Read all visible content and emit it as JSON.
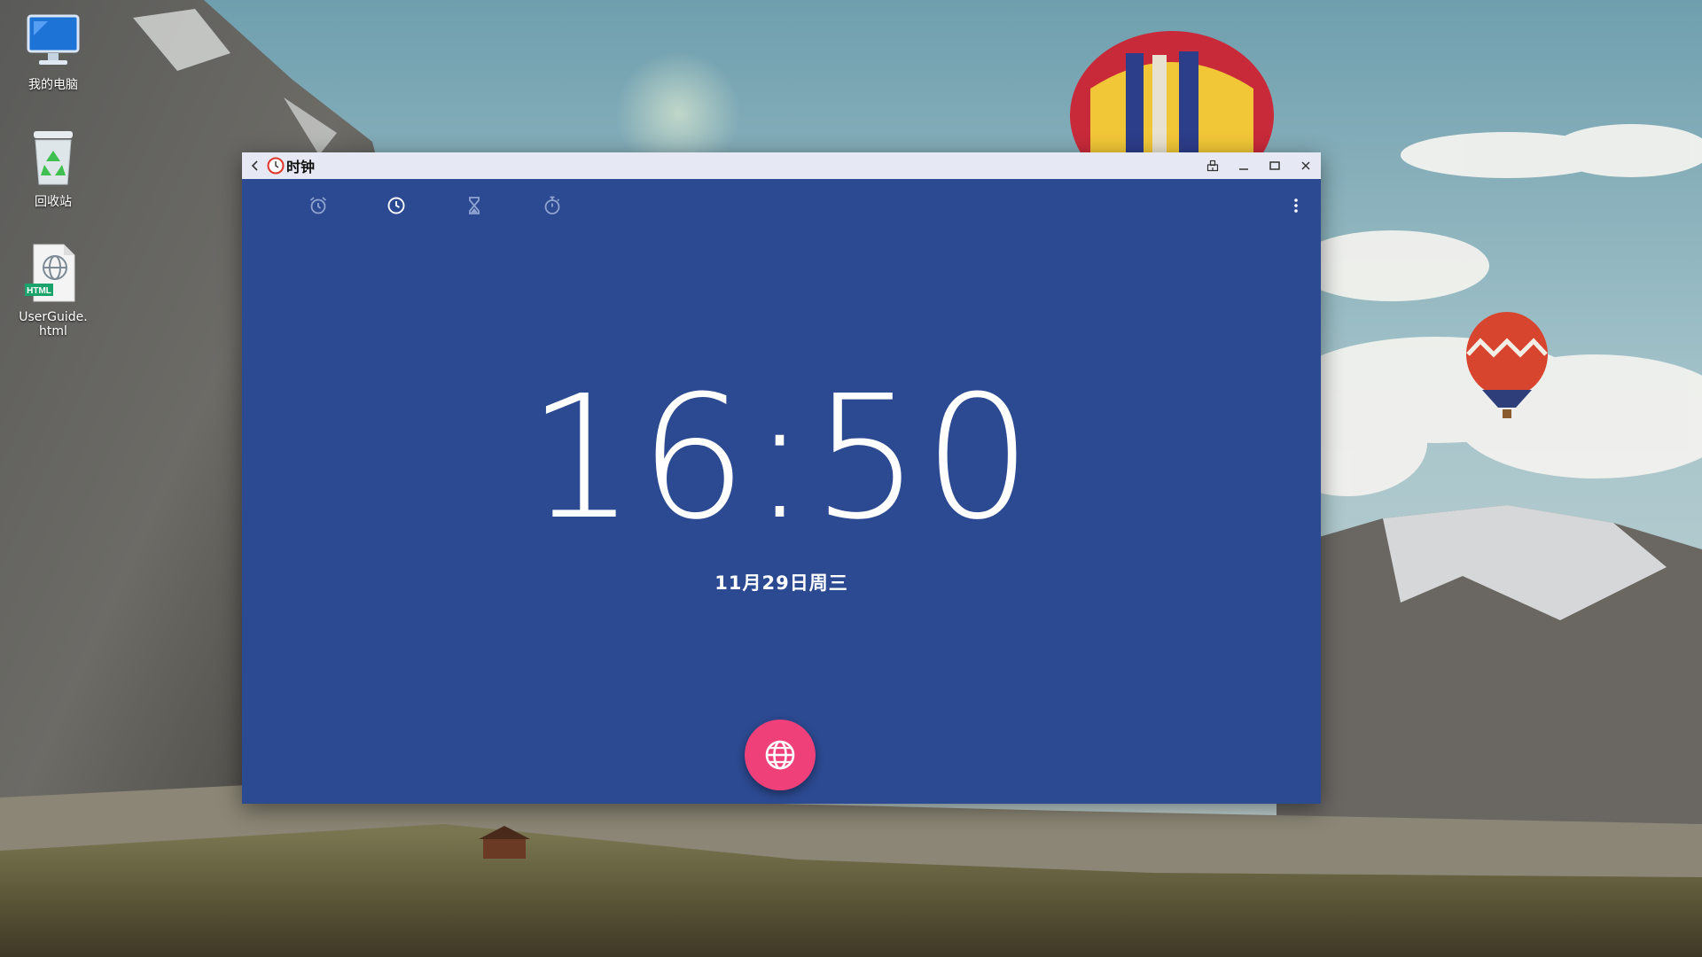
{
  "desktop": {
    "icons": [
      {
        "label": "我的电脑",
        "icon": "computer-icon"
      },
      {
        "label": "回收站",
        "icon": "recycle-bin-icon"
      },
      {
        "label": "UserGuide.html",
        "icon": "html-file-icon",
        "badge": "HTML"
      }
    ]
  },
  "window": {
    "title": "时钟",
    "app_icon": "clock-app-icon",
    "controls": [
      "pin-icon",
      "minimize-icon",
      "maximize-icon",
      "close-icon"
    ]
  },
  "clock_app": {
    "tabs": [
      {
        "name": "alarm",
        "icon": "alarm-icon",
        "selected": false
      },
      {
        "name": "clock",
        "icon": "clock-icon",
        "selected": true
      },
      {
        "name": "timer",
        "icon": "hourglass-icon",
        "selected": false
      },
      {
        "name": "stopwatch",
        "icon": "stopwatch-icon",
        "selected": false
      }
    ],
    "time": "16:50",
    "date": "11月29日周三",
    "fab_icon": "globe-icon"
  },
  "colors": {
    "app_background": "#2c4a91",
    "titlebar": "#e6e9f4",
    "fab": "#f0407a",
    "tab_active": "#ffffff",
    "tab_inactive": "#8fa3d1"
  }
}
